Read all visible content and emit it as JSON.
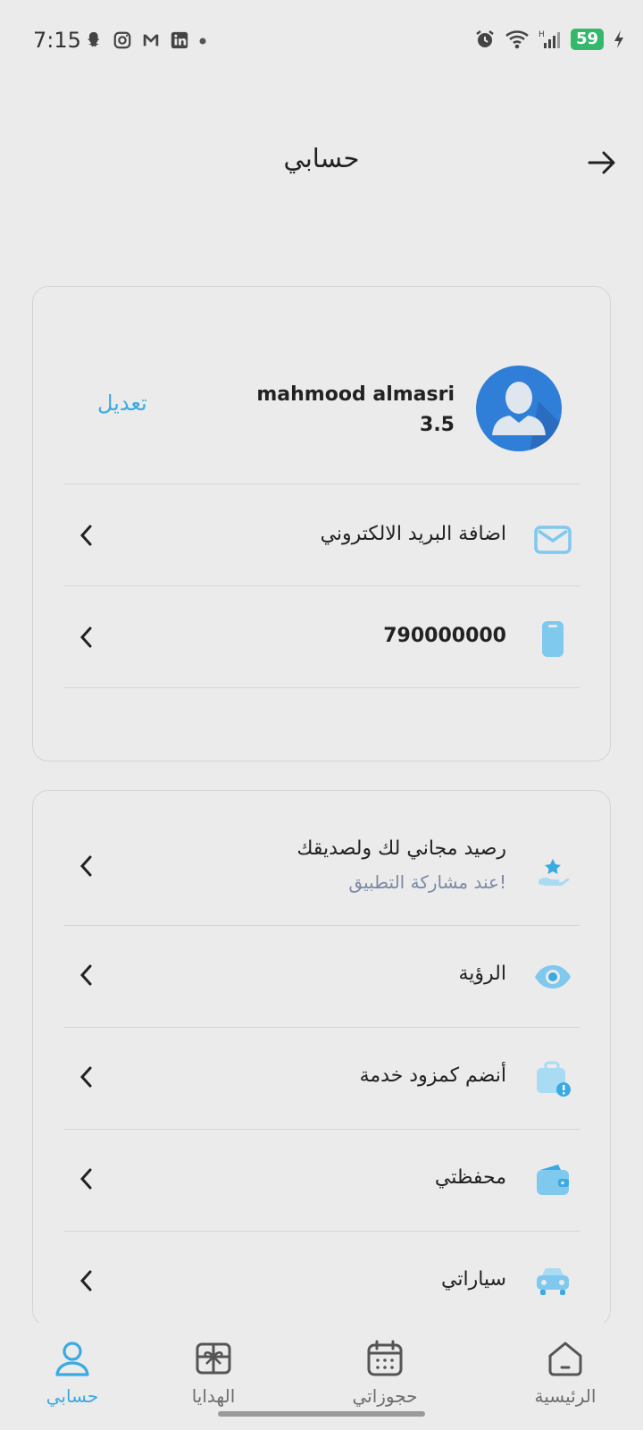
{
  "status_bar": {
    "time": "7:15",
    "battery": "59",
    "icons_left": [
      "snapchat-icon",
      "instagram-icon",
      "gmail-icon",
      "linkedin-icon",
      "dot-icon"
    ],
    "icons_right": [
      "alarm-icon",
      "wifi-icon",
      "signal-icon",
      "battery-icon",
      "charging-icon"
    ]
  },
  "header": {
    "title": "حسابي",
    "back_icon": "arrow-right-icon"
  },
  "profile": {
    "name": "mahmood almasri",
    "rating": "3.5",
    "edit_label": "تعديل",
    "rows": [
      {
        "label": "اضافة البريد الالكتروني",
        "icon": "envelope-icon"
      },
      {
        "label": "790000000",
        "icon": "phone-icon"
      }
    ]
  },
  "menu": {
    "rows": [
      {
        "label": "رصيد مجاني لك ولصديقك",
        "sublabel": "عند مشاركة التطبيق!",
        "icon": "gift-star-icon"
      },
      {
        "label": "الرؤية",
        "icon": "eye-icon"
      },
      {
        "label": "أنضم كمزود خدمة",
        "icon": "briefcase-alert-icon"
      },
      {
        "label": "محفظتي",
        "icon": "wallet-icon"
      },
      {
        "label": "سياراتي",
        "icon": "car-icon"
      }
    ]
  },
  "bottom_nav": {
    "items": [
      {
        "label": "حسابي",
        "icon": "user-icon",
        "active": true
      },
      {
        "label": "الهدايا",
        "icon": "gift-icon",
        "active": false
      },
      {
        "label": "حجوزاتي",
        "icon": "calendar-icon",
        "active": false
      },
      {
        "label": "الرئيسية",
        "icon": "home-icon",
        "active": false
      }
    ]
  },
  "colors": {
    "accent": "#3aaae2",
    "avatar_bg": "#2f7ed8",
    "icon_light": "#7fc8ee",
    "battery": "#34b86b"
  }
}
